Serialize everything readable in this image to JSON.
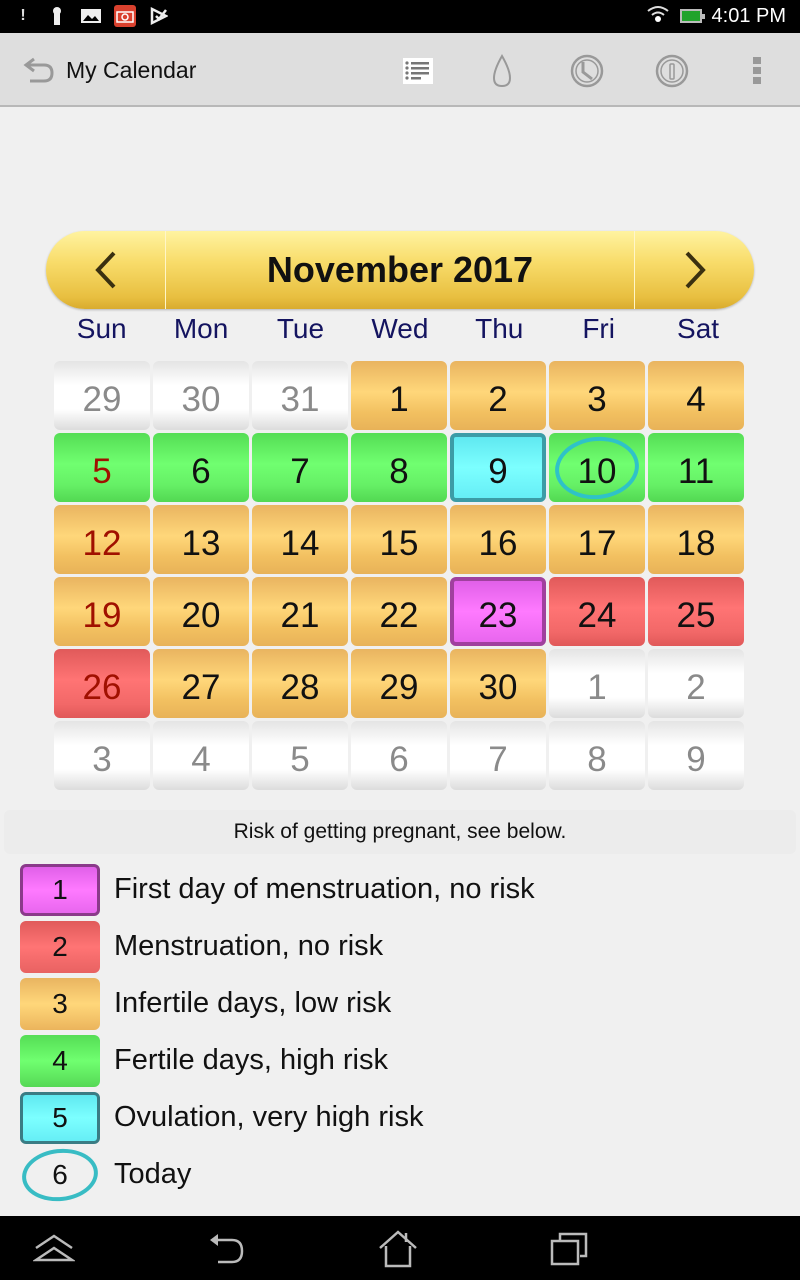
{
  "status_bar": {
    "time": "4:01 PM",
    "notification_icons": [
      "alert-icon",
      "keyhole-icon",
      "image-icon",
      "camera-icon",
      "check-icon"
    ],
    "battery_color": "#21a32c"
  },
  "action_bar": {
    "title": "My Calendar",
    "icons": [
      "list-icon",
      "drop-icon",
      "clock-icon",
      "info-icon",
      "overflow-menu-icon"
    ]
  },
  "calendar": {
    "month_title": "November 2017",
    "prev_label": "‹",
    "next_label": "›",
    "weekdays": [
      "Sun",
      "Mon",
      "Tue",
      "Wed",
      "Thu",
      "Fri",
      "Sat"
    ],
    "today": 10,
    "weeks": [
      [
        {
          "day": "29",
          "type": "other"
        },
        {
          "day": "30",
          "type": "other"
        },
        {
          "day": "31",
          "type": "other"
        },
        {
          "day": "1",
          "type": "infertile"
        },
        {
          "day": "2",
          "type": "infertile"
        },
        {
          "day": "3",
          "type": "infertile"
        },
        {
          "day": "4",
          "type": "infertile"
        }
      ],
      [
        {
          "day": "5",
          "type": "fertile"
        },
        {
          "day": "6",
          "type": "fertile"
        },
        {
          "day": "7",
          "type": "fertile"
        },
        {
          "day": "8",
          "type": "fertile"
        },
        {
          "day": "9",
          "type": "ovulation"
        },
        {
          "day": "10",
          "type": "fertile",
          "today": true
        },
        {
          "day": "11",
          "type": "fertile"
        }
      ],
      [
        {
          "day": "12",
          "type": "infertile"
        },
        {
          "day": "13",
          "type": "infertile"
        },
        {
          "day": "14",
          "type": "infertile"
        },
        {
          "day": "15",
          "type": "infertile"
        },
        {
          "day": "16",
          "type": "infertile"
        },
        {
          "day": "17",
          "type": "infertile"
        },
        {
          "day": "18",
          "type": "infertile"
        }
      ],
      [
        {
          "day": "19",
          "type": "infertile"
        },
        {
          "day": "20",
          "type": "infertile"
        },
        {
          "day": "21",
          "type": "infertile"
        },
        {
          "day": "22",
          "type": "infertile"
        },
        {
          "day": "23",
          "type": "first"
        },
        {
          "day": "24",
          "type": "menstruation"
        },
        {
          "day": "25",
          "type": "menstruation"
        }
      ],
      [
        {
          "day": "26",
          "type": "menstruation"
        },
        {
          "day": "27",
          "type": "infertile"
        },
        {
          "day": "28",
          "type": "infertile"
        },
        {
          "day": "29",
          "type": "infertile"
        },
        {
          "day": "30",
          "type": "infertile"
        },
        {
          "day": "1",
          "type": "other"
        },
        {
          "day": "2",
          "type": "other"
        }
      ],
      [
        {
          "day": "3",
          "type": "other"
        },
        {
          "day": "4",
          "type": "other"
        },
        {
          "day": "5",
          "type": "other"
        },
        {
          "day": "6",
          "type": "other"
        },
        {
          "day": "7",
          "type": "other"
        },
        {
          "day": "8",
          "type": "other"
        },
        {
          "day": "9",
          "type": "other"
        }
      ]
    ]
  },
  "legend": {
    "note": "Risk of getting pregnant, see below.",
    "items": [
      {
        "num": "1",
        "label": "First day of menstruation, no risk",
        "color": "#ff7aff"
      },
      {
        "num": "2",
        "label": "Menstruation, no risk",
        "color": "#ff7474"
      },
      {
        "num": "3",
        "label": "Infertile days, low risk",
        "color": "#ffd77a"
      },
      {
        "num": "4",
        "label": "Fertile days, high risk",
        "color": "#70ff70"
      },
      {
        "num": "5",
        "label": "Ovulation, very high risk",
        "color": "#7cffff"
      },
      {
        "num": "6",
        "label": "Today",
        "color": "#38bcc4"
      }
    ]
  },
  "nav_bar": {
    "buttons": [
      "collapse-button",
      "back-button",
      "home-button",
      "recents-button"
    ]
  }
}
